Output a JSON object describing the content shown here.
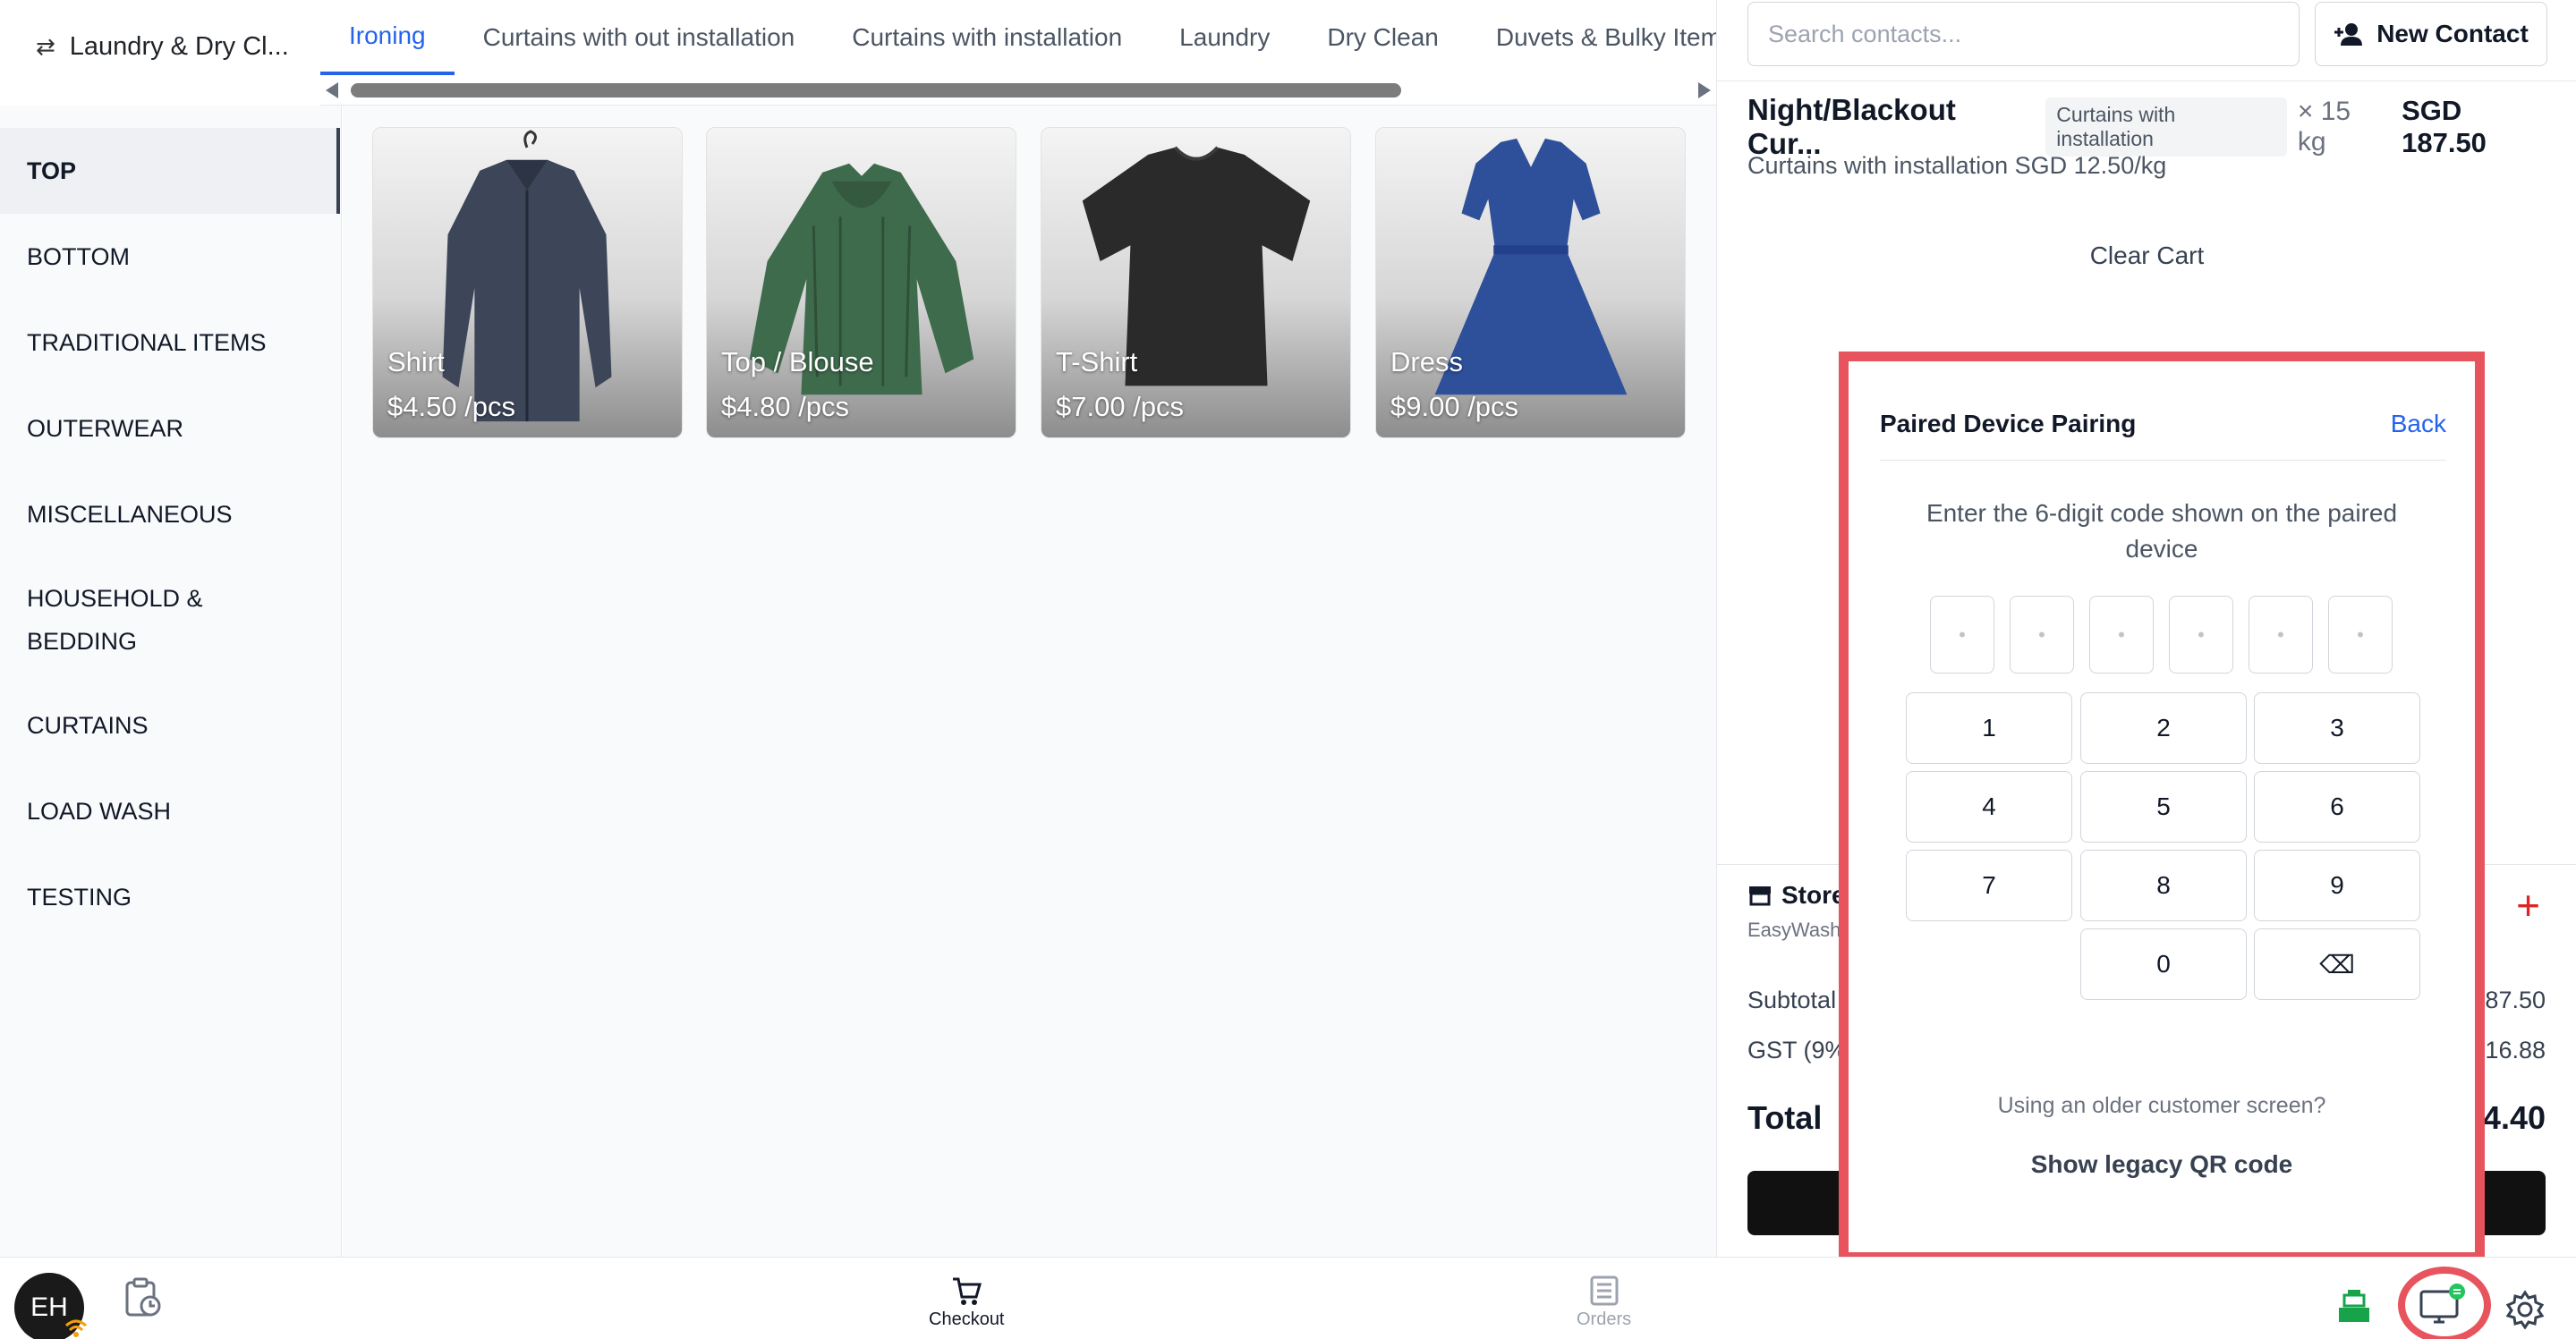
{
  "header": {
    "store_name": "Laundry & Dry Cl...",
    "tabs": [
      {
        "label": "Ironing",
        "active": true
      },
      {
        "label": "Curtains with out installation",
        "active": false
      },
      {
        "label": "Curtains with installation",
        "active": false
      },
      {
        "label": "Laundry",
        "active": false
      },
      {
        "label": "Dry Clean",
        "active": false
      },
      {
        "label": "Duvets & Bulky Item",
        "active": false
      }
    ]
  },
  "sidebar": {
    "categories": [
      {
        "label": "TOP",
        "active": true
      },
      {
        "label": "BOTTOM",
        "active": false
      },
      {
        "label": "TRADITIONAL ITEMS",
        "active": false
      },
      {
        "label": "OUTERWEAR",
        "active": false
      },
      {
        "label": "MISCELLANEOUS",
        "active": false
      },
      {
        "label": "HOUSEHOLD & BEDDING",
        "active": false
      },
      {
        "label": "CURTAINS",
        "active": false
      },
      {
        "label": "LOAD WASH",
        "active": false
      },
      {
        "label": "TESTING",
        "active": false
      }
    ]
  },
  "products": [
    {
      "name": "Shirt",
      "price": "$4.50 /pcs",
      "icon": "shirt-image"
    },
    {
      "name": "Top / Blouse",
      "price": "$4.80 /pcs",
      "icon": "blouse-image"
    },
    {
      "name": "T-Shirt",
      "price": "$7.00 /pcs",
      "icon": "tshirt-image"
    },
    {
      "name": "Dress",
      "price": "$9.00 /pcs",
      "icon": "dress-image"
    }
  ],
  "contacts": {
    "search_placeholder": "Search contacts...",
    "new_contact_label": "New Contact"
  },
  "cart": {
    "item_title": "Night/Blackout Cur...",
    "item_chip": "Curtains with installation",
    "item_qty": "× 15 kg",
    "item_price": "SGD 187.50",
    "item_sub": "Curtains with installation SGD 12.50/kg",
    "clear_label": "Clear Cart",
    "store_label": "Store",
    "store_sub": "EasyWash",
    "subtotal_label": "Subtotal",
    "subtotal_value": "87.50",
    "gst_label": "GST (9%",
    "gst_value": "16.88",
    "total_label": "Total",
    "total_value": "4.40"
  },
  "pairing": {
    "title": "Paired Device Pairing",
    "back_label": "Back",
    "instruction": "Enter the 6-digit code shown on the paired device",
    "code_placeholder": "•",
    "keys": [
      "1",
      "2",
      "3",
      "4",
      "5",
      "6",
      "7",
      "8",
      "9",
      "0",
      "⌫"
    ],
    "older_text": "Using an older customer screen?",
    "legacy_label": "Show legacy QR code"
  },
  "bottombar": {
    "avatar_initials": "EH",
    "checkout_label": "Checkout",
    "orders_label": "Orders"
  },
  "colors": {
    "accent": "#2563eb",
    "highlight": "#e8545d",
    "plus": "#dc2626",
    "register": "#16a34a"
  }
}
